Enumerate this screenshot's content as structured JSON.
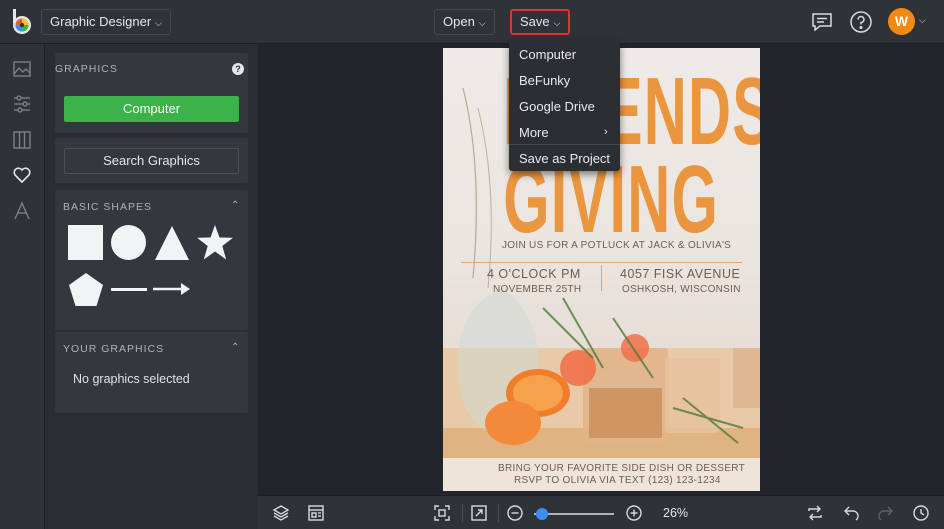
{
  "topbar": {
    "app_name": "Graphic Designer",
    "open_label": "Open",
    "save_label": "Save",
    "avatar_letter": "W",
    "accent_colors": {
      "avatar": "#f08a12",
      "save_highlight": "#e0352b"
    }
  },
  "save_menu": {
    "items": [
      {
        "label": "Computer"
      },
      {
        "label": "BeFunky"
      },
      {
        "label": "Google Drive"
      },
      {
        "label": "More"
      },
      {
        "label": "Save as Project"
      }
    ]
  },
  "left_rail": {
    "icons": [
      "image-icon",
      "sliders-icon",
      "layout-columns-icon",
      "heart-icon",
      "text-icon"
    ],
    "active": "heart-icon"
  },
  "panel": {
    "graphics_title": "GRAPHICS",
    "computer_button": "Computer",
    "search_button": "Search Graphics",
    "basic_shapes_title": "BASIC SHAPES",
    "shapes": [
      "square",
      "circle",
      "triangle",
      "star",
      "pentagon",
      "line",
      "arrow"
    ],
    "your_graphics_title": "YOUR GRAPHICS",
    "no_graphics": "No graphics selected"
  },
  "poster": {
    "headline_1": "FRIENDS",
    "headline_2": "GIVING",
    "invite": "JOIN US FOR A POTLUCK AT JACK & OLIVIA'S",
    "time": "4 O'CLOCK PM",
    "date": "NOVEMBER 25TH",
    "address": "4057 FISK AVENUE",
    "city": "OSHKOSH, WISCONSIN",
    "footer_1": "BRING YOUR FAVORITE SIDE DISH OR DESSERT",
    "footer_2": "RSVP TO OLIVIA VIA TEXT (123) 123-1234",
    "headline_color": "#ea963e"
  },
  "bottombar": {
    "zoom_label": "26%",
    "zoom_value": 0.26
  }
}
